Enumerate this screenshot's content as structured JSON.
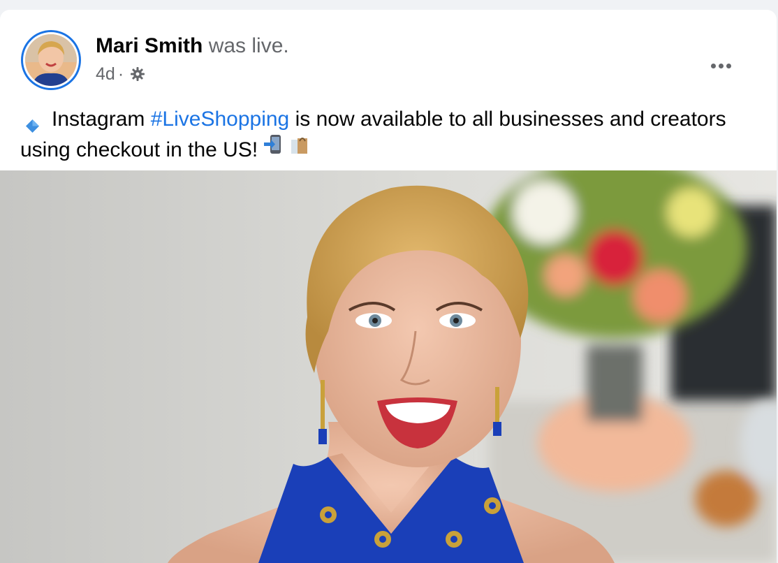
{
  "post": {
    "author_name": "Mari Smith",
    "author_action": "was live.",
    "timestamp": "4d",
    "separator": "·",
    "audience_icon": "gear-icon",
    "text_before_hashtag": "Instagram",
    "hashtag": "#LiveShopping",
    "text_after_hashtag": "is now available to all businesses and creators using checkout in the US!",
    "leading_emoji_icon": "blue-diamond-icon",
    "trailing_emoji_icons": [
      "mobile-arrow-icon",
      "shopping-bag-icon"
    ],
    "more_icon": "more-options-icon"
  },
  "colors": {
    "link_blue": "#1b74e4",
    "secondary_text": "#65676b",
    "primary_text": "#050505",
    "dress_blue": "#1a3fb8"
  }
}
